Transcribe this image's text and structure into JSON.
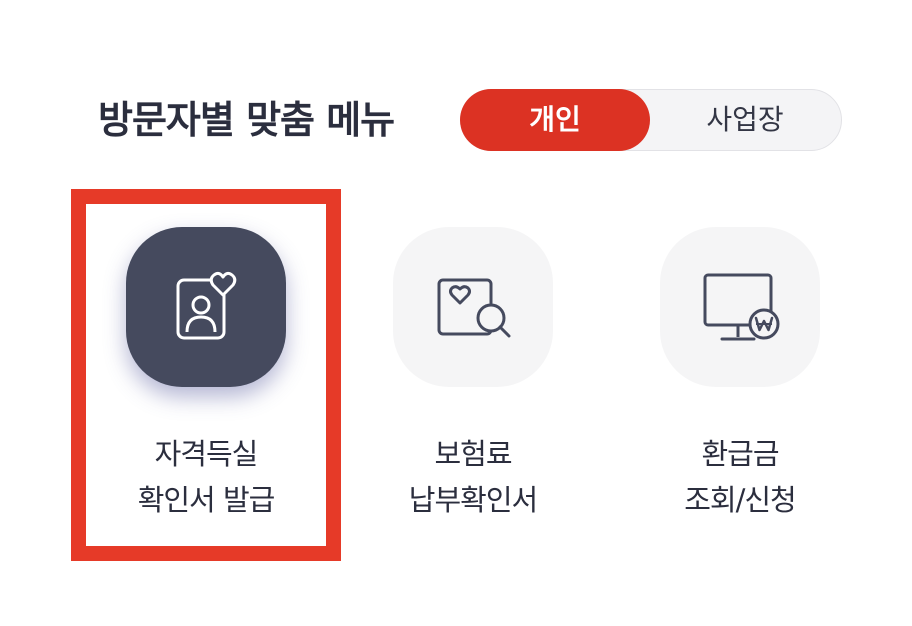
{
  "section": {
    "title": "방문자별 맞춤 메뉴"
  },
  "toggle": {
    "personal_label": "개인",
    "business_label": "사업장",
    "selected": "개인"
  },
  "menu": {
    "items": [
      {
        "line1": "자격득실",
        "line2": "확인서 발급",
        "icon": "id-card-heart-icon",
        "active": true
      },
      {
        "line1": "보험료",
        "line2": "납부확인서",
        "icon": "photo-heart-search-icon",
        "active": false
      },
      {
        "line1": "환급금",
        "line2": "조회/신청",
        "icon": "monitor-won-icon",
        "active": false
      }
    ]
  },
  "colors": {
    "accent": "#dc3223",
    "highlight_border": "#e63a28",
    "active_icon_bg": "#454a5e",
    "icon_bg": "#f5f5f6",
    "text": "#2b2e3e"
  }
}
